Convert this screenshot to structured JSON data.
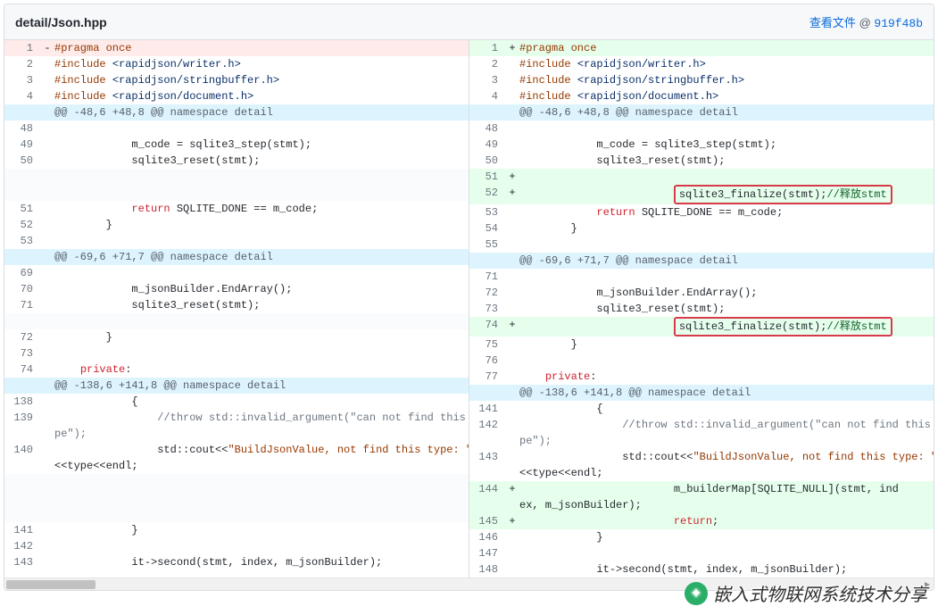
{
  "header": {
    "file_path": "detail/Json.hpp",
    "view_file_label": "查看文件",
    "at": "@",
    "commit_hash": "919f48b"
  },
  "hunks": {
    "h1": "@@ -48,6 +48,8 @@ namespace detail",
    "h2": "@@ -69,6 +71,7 @@ namespace detail",
    "h3": "@@ -138,6 +141,8 @@ namespace detail"
  },
  "left": [
    {
      "n": "1",
      "t": "del",
      "html": "<span class='pp'>#pragma once</span>"
    },
    {
      "n": "2",
      "t": "ctx",
      "html": "<span class='pp'>#include </span><span class='s'>&lt;rapidjson/writer.h&gt;</span>"
    },
    {
      "n": "3",
      "t": "ctx",
      "html": "<span class='pp'>#include </span><span class='s'>&lt;rapidjson/stringbuffer.h&gt;</span>"
    },
    {
      "n": "4",
      "t": "ctx",
      "html": "<span class='pp'>#include </span><span class='s'>&lt;rapidjson/document.h&gt;</span>"
    },
    {
      "n": "",
      "t": "hunk",
      "bind": "hunks.h1"
    },
    {
      "n": "48",
      "t": "ctx",
      "html": ""
    },
    {
      "n": "49",
      "t": "ctx",
      "html": "            m_code = sqlite3_step(stmt);"
    },
    {
      "n": "50",
      "t": "ctx",
      "html": "            sqlite3_reset(stmt);"
    },
    {
      "n": "",
      "t": "pad",
      "html": ""
    },
    {
      "n": "",
      "t": "pad",
      "html": ""
    },
    {
      "n": "51",
      "t": "ctx",
      "html": "            <span class='k'>return</span> SQLITE_DONE == m_code;"
    },
    {
      "n": "52",
      "t": "ctx",
      "html": "        }"
    },
    {
      "n": "53",
      "t": "ctx",
      "html": ""
    },
    {
      "n": "",
      "t": "hunk",
      "bind": "hunks.h2"
    },
    {
      "n": "69",
      "t": "ctx",
      "html": ""
    },
    {
      "n": "70",
      "t": "ctx",
      "html": "            m_jsonBuilder.EndArray();"
    },
    {
      "n": "71",
      "t": "ctx",
      "html": "            sqlite3_reset(stmt);"
    },
    {
      "n": "",
      "t": "pad",
      "html": ""
    },
    {
      "n": "72",
      "t": "ctx",
      "html": "        }"
    },
    {
      "n": "73",
      "t": "ctx",
      "html": ""
    },
    {
      "n": "74",
      "t": "ctx",
      "html": "    <span class='k'>private</span>:"
    },
    {
      "n": "",
      "t": "hunk",
      "bind": "hunks.h3"
    },
    {
      "n": "138",
      "t": "ctx",
      "html": "            {"
    },
    {
      "n": "139",
      "t": "ctx",
      "html": "                <span class='c'>//throw std::invalid_argument(\"can not find this ty</span>\npe\");",
      "wrap": true,
      "wrap_html": "                <span class='c'>//throw std::invalid_argument(\"can not find this ty</span>",
      "wrap_html2": "<span class='c'>pe\");</span>"
    },
    {
      "n": "140",
      "t": "ctx",
      "wrap": true,
      "wrap_html": "                std::cout&lt;&lt;<span class='sbrown'>\"BuildJsonValue, not find this type: \"</span>",
      "wrap_html2": "&lt;&lt;type&lt;&lt;endl;"
    },
    {
      "n": "",
      "t": "pad",
      "html": ""
    },
    {
      "n": "",
      "t": "pad",
      "html": ""
    },
    {
      "n": "",
      "t": "pad",
      "html": ""
    },
    {
      "n": "141",
      "t": "ctx",
      "html": "            }"
    },
    {
      "n": "142",
      "t": "ctx",
      "html": ""
    },
    {
      "n": "143",
      "t": "ctx",
      "html": "            it-&gt;second(stmt, index, m_jsonBuilder);"
    }
  ],
  "right": [
    {
      "n": "1",
      "t": "add",
      "html": "<span class='pp'>#pragma once</span>"
    },
    {
      "n": "2",
      "t": "ctx",
      "html": "<span class='pp'>#include </span><span class='s'>&lt;rapidjson/writer.h&gt;</span>"
    },
    {
      "n": "3",
      "t": "ctx",
      "html": "<span class='pp'>#include </span><span class='s'>&lt;rapidjson/stringbuffer.h&gt;</span>"
    },
    {
      "n": "4",
      "t": "ctx",
      "html": "<span class='pp'>#include </span><span class='s'>&lt;rapidjson/document.h&gt;</span>"
    },
    {
      "n": "",
      "t": "hunk",
      "bind": "hunks.h1"
    },
    {
      "n": "48",
      "t": "ctx",
      "html": ""
    },
    {
      "n": "49",
      "t": "ctx",
      "html": "            m_code = sqlite3_step(stmt);"
    },
    {
      "n": "50",
      "t": "ctx",
      "html": "            sqlite3_reset(stmt);"
    },
    {
      "n": "51",
      "t": "add",
      "html": ""
    },
    {
      "n": "52",
      "t": "add",
      "boxed": true,
      "html": "                        sqlite3_finalize(stmt);<span class='c2'>//释放stmt</span>"
    },
    {
      "n": "53",
      "t": "ctx",
      "html": "            <span class='k'>return</span> SQLITE_DONE == m_code;"
    },
    {
      "n": "54",
      "t": "ctx",
      "html": "        }"
    },
    {
      "n": "55",
      "t": "ctx",
      "html": ""
    },
    {
      "n": "",
      "t": "hunk",
      "bind": "hunks.h2"
    },
    {
      "n": "71",
      "t": "ctx",
      "html": ""
    },
    {
      "n": "72",
      "t": "ctx",
      "html": "            m_jsonBuilder.EndArray();"
    },
    {
      "n": "73",
      "t": "ctx",
      "html": "            sqlite3_reset(stmt);"
    },
    {
      "n": "74",
      "t": "add",
      "boxed": true,
      "html": "                        sqlite3_finalize(stmt);<span class='c2'>//释放stmt</span>"
    },
    {
      "n": "75",
      "t": "ctx",
      "html": "        }"
    },
    {
      "n": "76",
      "t": "ctx",
      "html": ""
    },
    {
      "n": "77",
      "t": "ctx",
      "html": "    <span class='k'>private</span>:"
    },
    {
      "n": "",
      "t": "hunk",
      "bind": "hunks.h3"
    },
    {
      "n": "141",
      "t": "ctx",
      "html": "            {"
    },
    {
      "n": "142",
      "t": "ctx",
      "wrap": true,
      "wrap_html": "                <span class='c'>//throw std::invalid_argument(\"can not find this ty</span>",
      "wrap_html2": "<span class='c'>pe\");</span>"
    },
    {
      "n": "143",
      "t": "ctx",
      "wrap": true,
      "wrap_html": "                std::cout&lt;&lt;<span class='sbrown'>\"BuildJsonValue, not find this type: \"</span>",
      "wrap_html2": "&lt;&lt;type&lt;&lt;endl;"
    },
    {
      "n": "144",
      "t": "add",
      "wrap": true,
      "wrap_html": "                        m_builderMap[SQLITE_NULL](stmt, ind",
      "wrap_html2": "ex, m_jsonBuilder);"
    },
    {
      "n": "145",
      "t": "add",
      "html": "                        <span class='k'>return</span>;"
    },
    {
      "n": "146",
      "t": "ctx",
      "html": "            }"
    },
    {
      "n": "147",
      "t": "ctx",
      "html": ""
    },
    {
      "n": "148",
      "t": "ctx",
      "html": "            it-&gt;second(stmt, index, m_jsonBuilder);"
    }
  ],
  "watermark": "嵌入式物联网系统技术分享"
}
